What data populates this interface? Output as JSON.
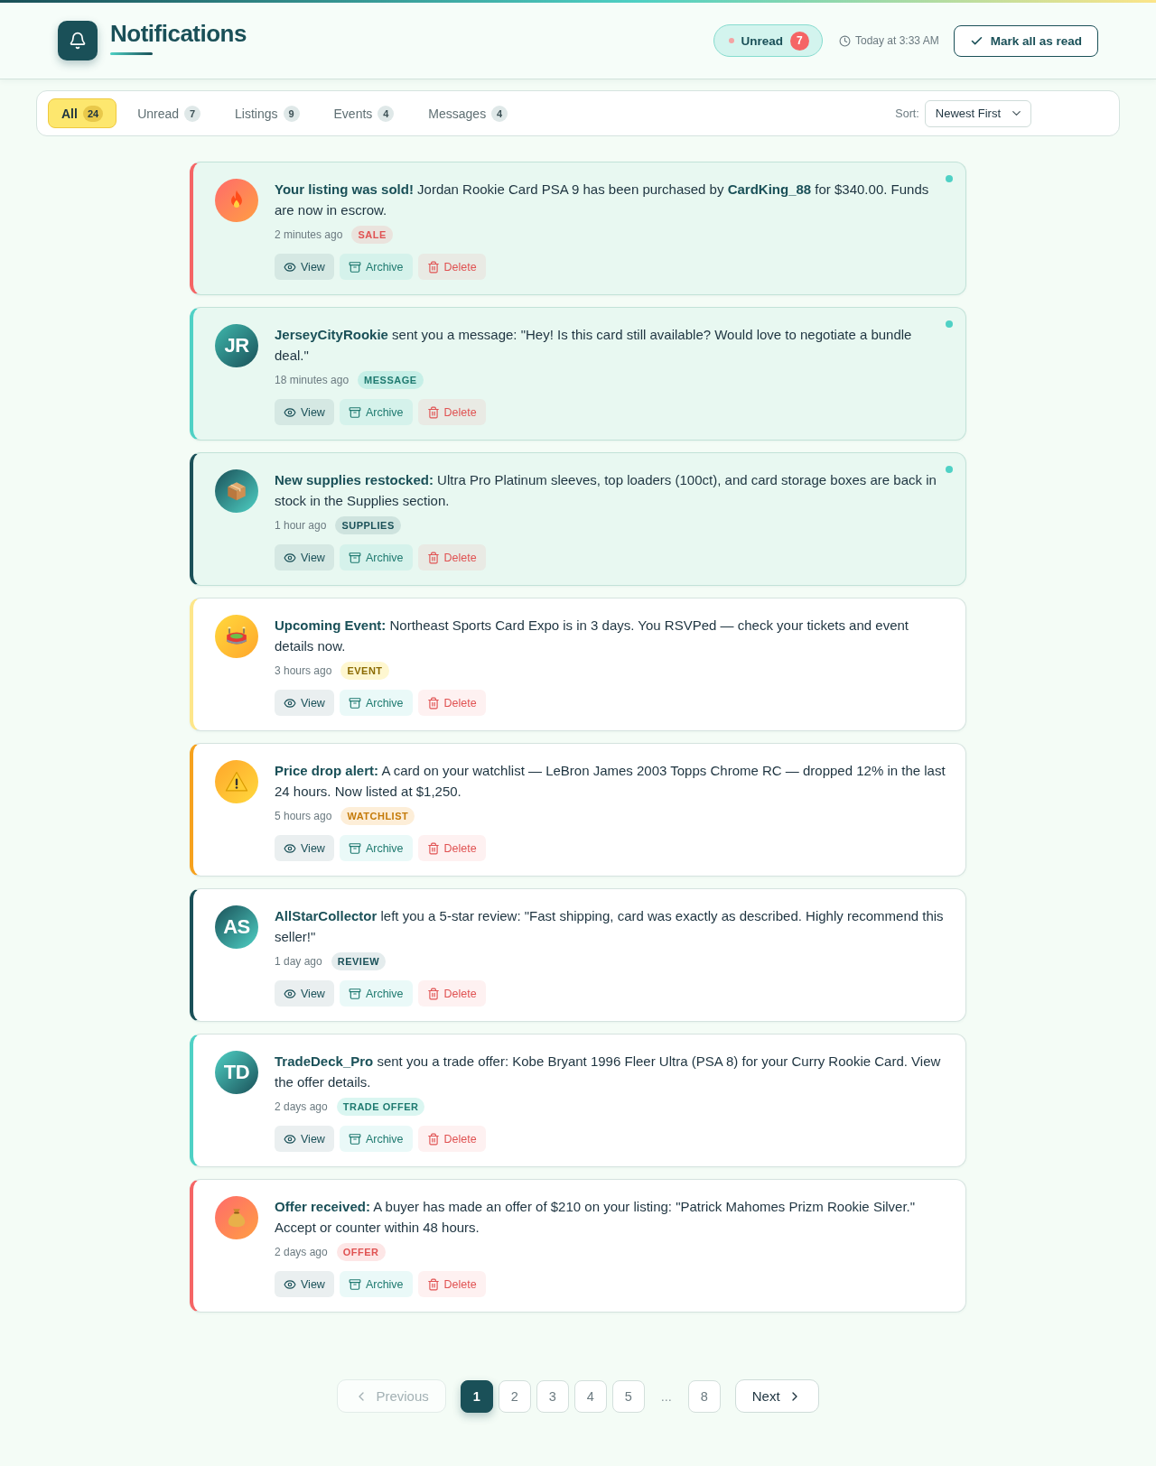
{
  "header": {
    "title": "Notifications",
    "unread_status": {
      "label": "Unread",
      "count": "7"
    },
    "timestamp": "Today at 3:33 AM",
    "mark_all_button": "Mark all as read"
  },
  "filters": {
    "tabs": [
      {
        "label": "All",
        "count": "24",
        "selected": true
      },
      {
        "label": "Unread",
        "count": "7",
        "selected": false
      },
      {
        "label": "Listings",
        "count": "9",
        "selected": false
      },
      {
        "label": "Events",
        "count": "4",
        "selected": false
      },
      {
        "label": "Messages",
        "count": "4",
        "selected": false
      }
    ],
    "sort": {
      "label": "Sort:",
      "value": "Newest First"
    }
  },
  "notifications": [
    {
      "kind": "sale",
      "unread": true,
      "text": "**Your listing was sold!** Jordan Rookie Card PSA 9 has been purchased by **CardKing_88** for $340.00. Funds are now in escrow.",
      "time": "2 minutes ago",
      "tag": "SALE",
      "actions": [
        {
          "kind": "view",
          "label": "View"
        },
        {
          "kind": "archive",
          "label": "Archive"
        },
        {
          "kind": "delete",
          "label": "Delete"
        }
      ]
    },
    {
      "kind": "message",
      "unread": true,
      "initials": "JR",
      "text": "**JerseyCityRookie** sent you a message: \"Hey! Is this card still available? Would love to negotiate a bundle deal.\"",
      "time": "18 minutes ago",
      "tag": "MESSAGE",
      "actions": [
        {
          "kind": "view",
          "label": "View"
        },
        {
          "kind": "archive",
          "label": "Archive"
        },
        {
          "kind": "delete",
          "label": "Delete"
        }
      ]
    },
    {
      "kind": "supplies",
      "unread": true,
      "text": "**New supplies restocked:** Ultra Pro Platinum sleeves, top loaders (100ct), and card storage boxes are back in stock in the Supplies section.",
      "time": "1 hour ago",
      "tag": "SUPPLIES",
      "actions": [
        {
          "kind": "view",
          "label": "View"
        },
        {
          "kind": "archive",
          "label": "Archive"
        },
        {
          "kind": "delete",
          "label": "Delete"
        }
      ]
    },
    {
      "kind": "event",
      "unread": false,
      "text": "**Upcoming Event:** Northeast Sports Card Expo is in 3 days. You RSVPed — check your tickets and event details now.",
      "time": "3 hours ago",
      "tag": "EVENT",
      "actions": [
        {
          "kind": "view",
          "label": "View"
        },
        {
          "kind": "archive",
          "label": "Archive"
        },
        {
          "kind": "delete",
          "label": "Delete"
        }
      ]
    },
    {
      "kind": "watchlist",
      "unread": false,
      "text": "**Price drop alert:** A card on your watchlist — LeBron James 2003 Topps Chrome RC — dropped 12% in the last 24 hours. Now listed at $1,250.",
      "time": "5 hours ago",
      "tag": "WATCHLIST",
      "actions": [
        {
          "kind": "view",
          "label": "View"
        },
        {
          "kind": "archive",
          "label": "Archive"
        },
        {
          "kind": "delete",
          "label": "Delete"
        }
      ]
    },
    {
      "kind": "review",
      "unread": false,
      "initials": "AS",
      "text": "**AllStarCollector** left you a 5-star review: \"Fast shipping, card was exactly as described. Highly recommend this seller!\"",
      "time": "1 day ago",
      "tag": "REVIEW",
      "actions": [
        {
          "kind": "view",
          "label": "View"
        },
        {
          "kind": "archive",
          "label": "Archive"
        },
        {
          "kind": "delete",
          "label": "Delete"
        }
      ]
    },
    {
      "kind": "trade",
      "unread": false,
      "initials": "TD",
      "text": "**TradeDeck_Pro** sent you a trade offer: Kobe Bryant 1996 Fleer Ultra (PSA 8) for your Curry Rookie Card. View the offer details.",
      "time": "2 days ago",
      "tag": "TRADE OFFER",
      "actions": [
        {
          "kind": "view",
          "label": "View"
        },
        {
          "kind": "archive",
          "label": "Archive"
        },
        {
          "kind": "delete",
          "label": "Delete"
        }
      ]
    },
    {
      "kind": "offer",
      "unread": false,
      "text": "**Offer received:** A buyer has made an offer of $210 on your listing: \"Patrick Mahomes Prizm Rookie Silver.\" Accept or counter within 48 hours.",
      "time": "2 days ago",
      "tag": "OFFER",
      "actions": [
        {
          "kind": "view",
          "label": "View"
        },
        {
          "kind": "archive",
          "label": "Archive"
        },
        {
          "kind": "delete",
          "label": "Delete"
        }
      ]
    }
  ],
  "pagination": {
    "previous": {
      "label": "Previous",
      "disabled": true
    },
    "pages": [
      {
        "kind": "page",
        "label": "1",
        "selected": true
      },
      {
        "kind": "page",
        "label": "2",
        "selected": false
      },
      {
        "kind": "page",
        "label": "3",
        "selected": false
      },
      {
        "kind": "page",
        "label": "4",
        "selected": false
      },
      {
        "kind": "page",
        "label": "5",
        "selected": false
      },
      {
        "kind": "ellipsis",
        "label": "...",
        "selected": false
      },
      {
        "kind": "page",
        "label": "8",
        "selected": false
      }
    ],
    "next": {
      "label": "Next",
      "disabled": false
    }
  }
}
